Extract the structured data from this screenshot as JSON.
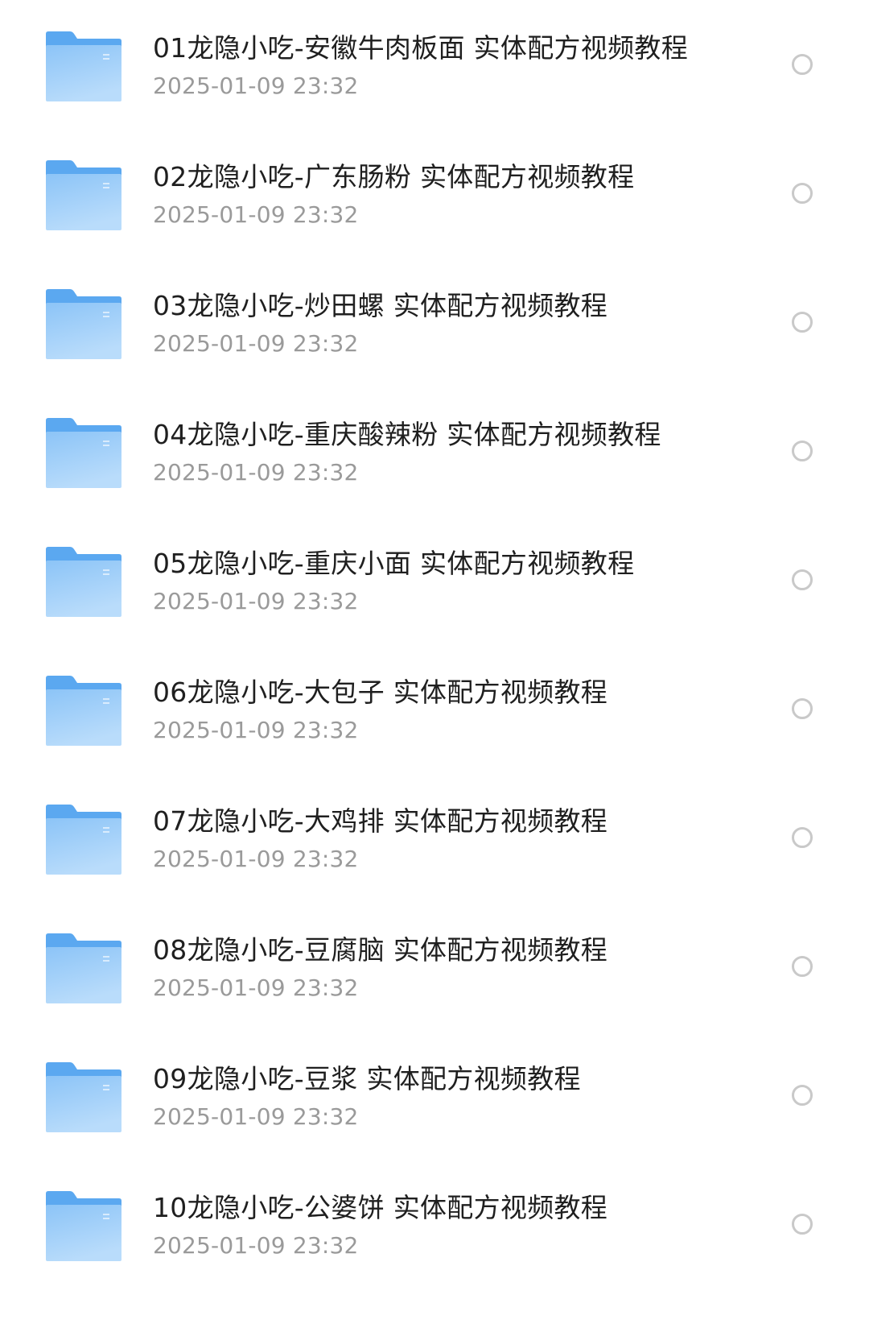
{
  "file_list": {
    "items": [
      {
        "name": "01龙隐小吃-安徽牛肉板面 实体配方视频教程",
        "date": "2025-01-09 23:32",
        "icon": "folder-icon",
        "selected": false
      },
      {
        "name": "02龙隐小吃-广东肠粉 实体配方视频教程",
        "date": "2025-01-09 23:32",
        "icon": "folder-icon",
        "selected": false
      },
      {
        "name": "03龙隐小吃-炒田螺 实体配方视频教程",
        "date": "2025-01-09 23:32",
        "icon": "folder-icon",
        "selected": false
      },
      {
        "name": "04龙隐小吃-重庆酸辣粉 实体配方视频教程",
        "date": "2025-01-09 23:32",
        "icon": "folder-icon",
        "selected": false
      },
      {
        "name": "05龙隐小吃-重庆小面 实体配方视频教程",
        "date": "2025-01-09 23:32",
        "icon": "folder-icon",
        "selected": false
      },
      {
        "name": "06龙隐小吃-大包子 实体配方视频教程",
        "date": "2025-01-09 23:32",
        "icon": "folder-icon",
        "selected": false
      },
      {
        "name": "07龙隐小吃-大鸡排 实体配方视频教程",
        "date": "2025-01-09 23:32",
        "icon": "folder-icon",
        "selected": false
      },
      {
        "name": "08龙隐小吃-豆腐脑 实体配方视频教程",
        "date": "2025-01-09 23:32",
        "icon": "folder-icon",
        "selected": false
      },
      {
        "name": "09龙隐小吃-豆浆 实体配方视频教程",
        "date": "2025-01-09 23:32",
        "icon": "folder-icon",
        "selected": false
      },
      {
        "name": "10龙隐小吃-公婆饼 实体配方视频教程",
        "date": "2025-01-09 23:32",
        "icon": "folder-icon",
        "selected": false
      }
    ]
  },
  "colors": {
    "folder_back": "#5ba8f0",
    "folder_front_top": "#8cc4f7",
    "folder_front_bottom": "#b9dcfb",
    "name_text": "#1f1f1f",
    "date_text": "#9a9a9a",
    "radio_border": "#c9c9c9"
  }
}
